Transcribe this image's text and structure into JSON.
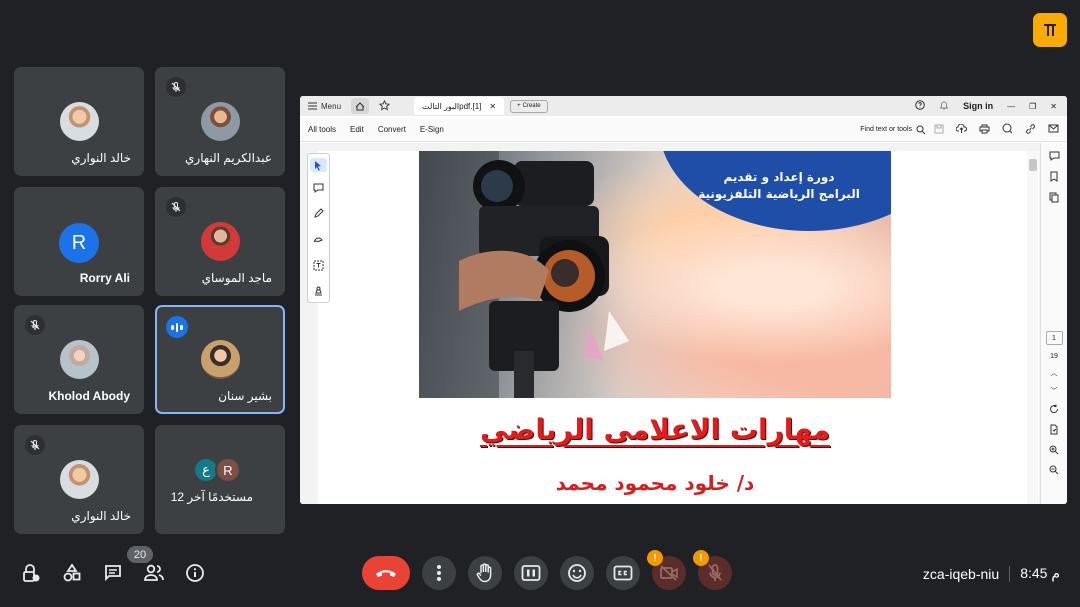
{
  "participants": [
    {
      "name": "خالد النواري",
      "muted": false
    },
    {
      "name": "عبدالكريم النهاري",
      "muted": true
    },
    {
      "name": "Rorry Ali",
      "initial": "R",
      "muted": false
    },
    {
      "name": "ماجد الموساي",
      "muted": true
    },
    {
      "name": "Kholod Abody",
      "muted": true
    },
    {
      "name": "بشير سنان",
      "speaking": true
    },
    {
      "name": "خالد النواري",
      "muted": true
    },
    {
      "name": "12 مستخدمًا آخر",
      "initials": [
        "ع",
        "R"
      ]
    }
  ],
  "shared_screen": {
    "titlebar": {
      "menu_label": "Menu",
      "tab_title": "pdf.[1]البور التالت",
      "create_label": "Create",
      "signin_label": "Sign in"
    },
    "toolbar": {
      "items": [
        "All tools",
        "Edit",
        "Convert",
        "E-Sign"
      ],
      "find_label": "Find text or tools"
    },
    "page": {
      "photo_title_line1": "دورة إعداد و تقديم",
      "photo_title_line2": "البرامج الرياضية التلفزيونية",
      "main_title": "مهارات الاعلامى الرياضي",
      "author": "د/ خلود محمود محمد"
    },
    "page_indicator": {
      "current": "1",
      "total": "19"
    }
  },
  "bottom": {
    "participant_count": "20",
    "meeting_code": "zca-iqeb-niu",
    "time": "8:45 م"
  },
  "colors": {
    "background": "#202124",
    "tile": "#3c4043",
    "hangup": "#ea4335",
    "accent": "#1a73e8",
    "badge": "#f9ab00",
    "warning": "#f29900"
  }
}
